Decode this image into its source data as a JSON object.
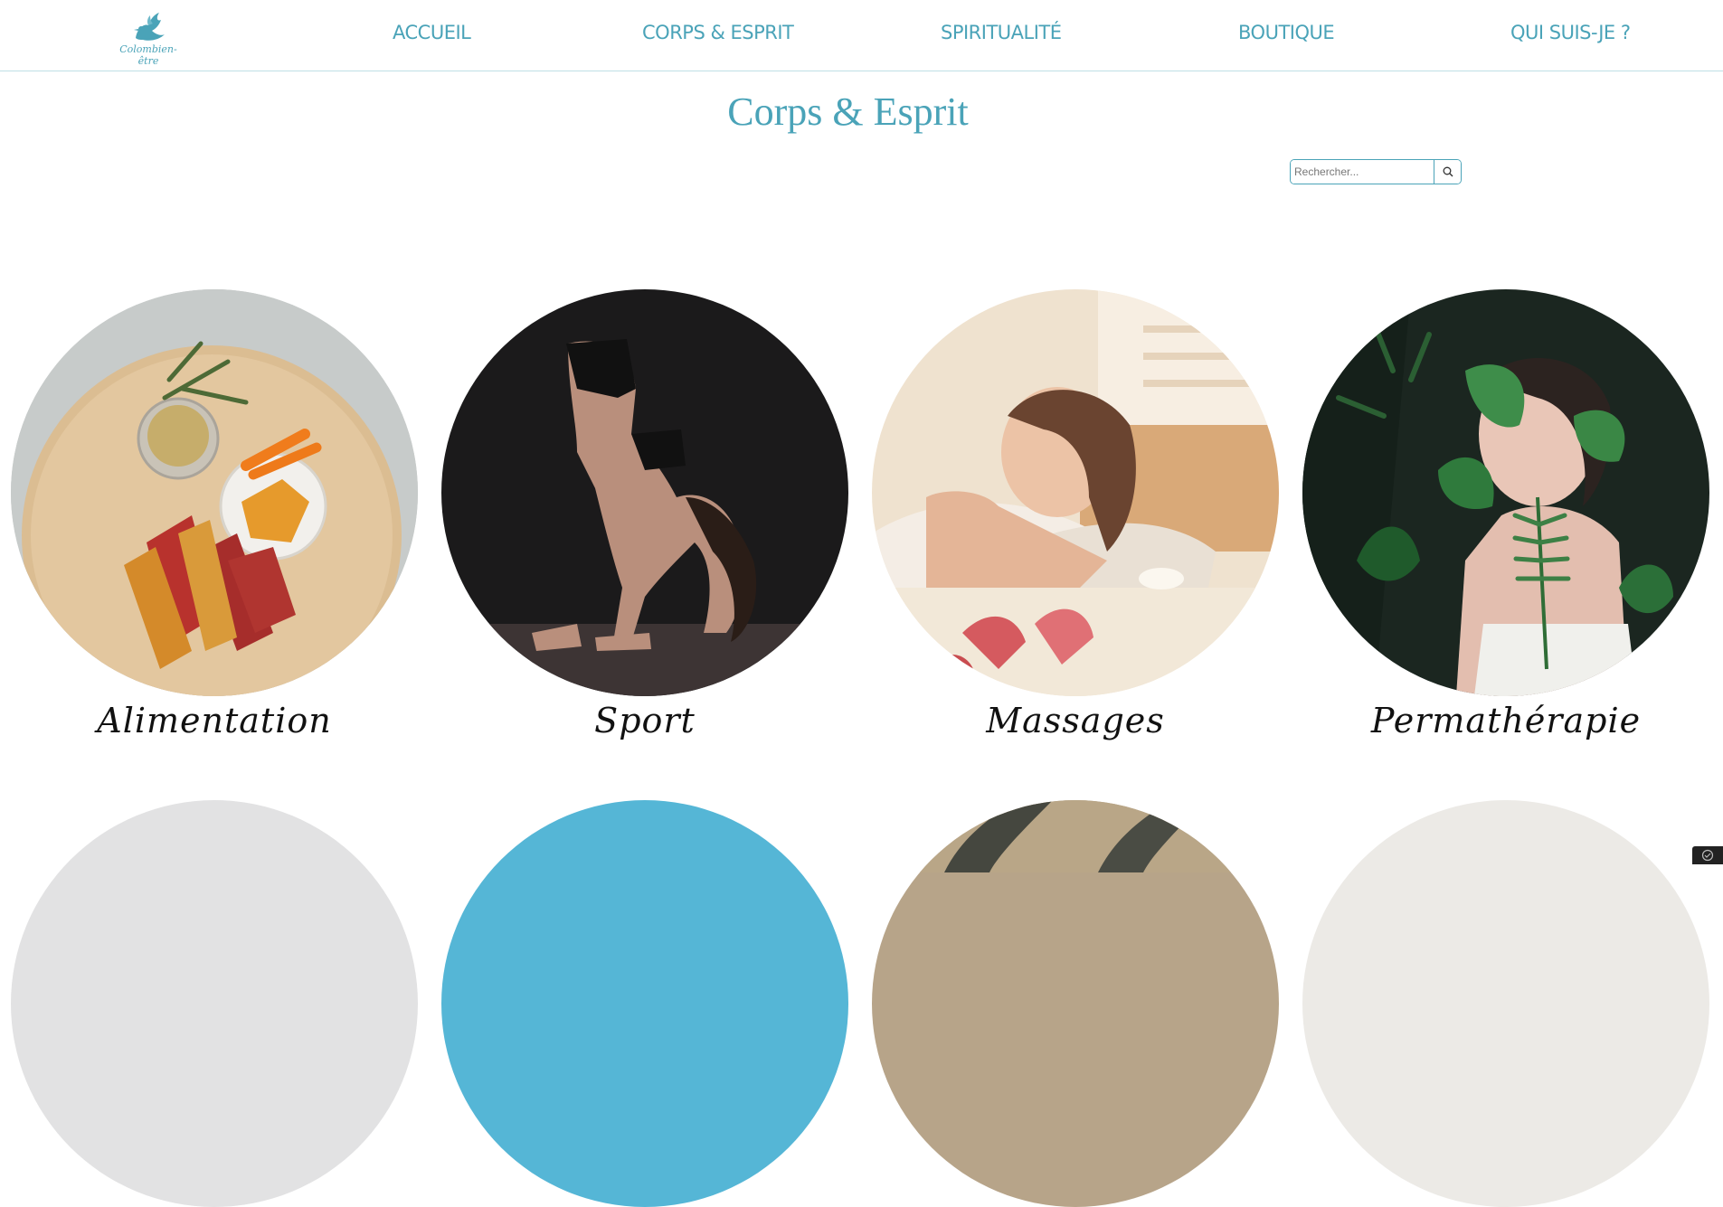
{
  "header": {
    "logo_text": "Colombien-être",
    "nav": [
      {
        "label": "ACCUEIL"
      },
      {
        "label": "CORPS & ESPRIT"
      },
      {
        "label": "SPIRITUALITÉ"
      },
      {
        "label": "BOUTIQUE"
      },
      {
        "label": "QUI SUIS-JE ?"
      }
    ]
  },
  "main": {
    "title": "Corps & Esprit",
    "search": {
      "placeholder": "Rechercher..."
    },
    "categories": [
      {
        "label": "Alimentation"
      },
      {
        "label": "Sport"
      },
      {
        "label": "Massages"
      },
      {
        "label": "Permathérapie"
      }
    ]
  },
  "colors": {
    "accent": "#4aa3b8",
    "text_dark": "#111111"
  }
}
